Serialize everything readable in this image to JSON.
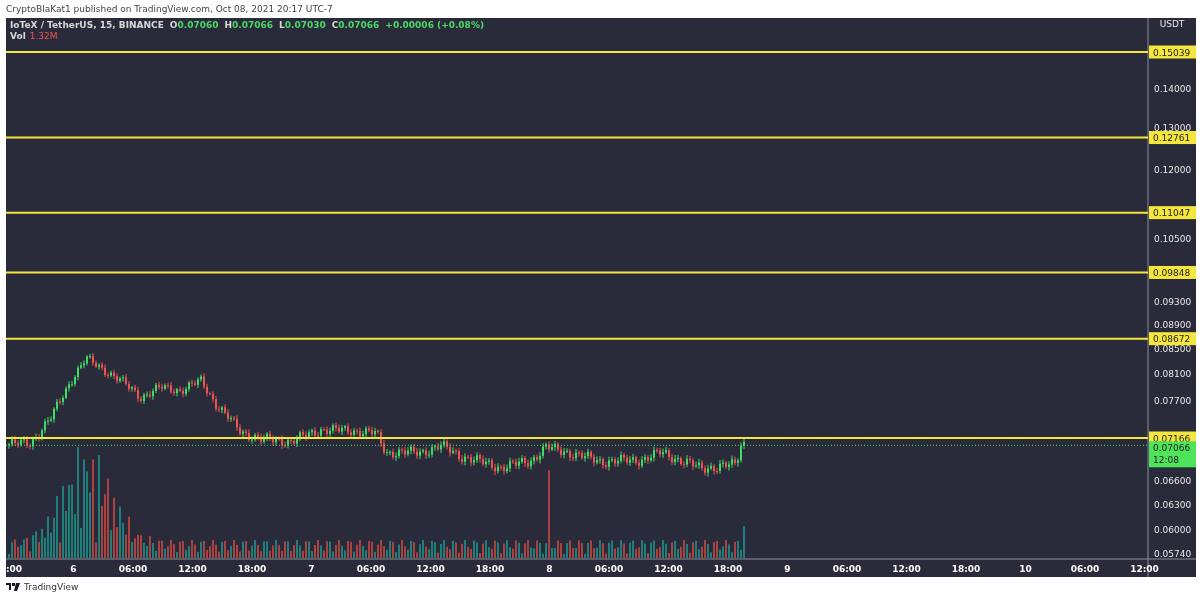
{
  "publish_line": "CryptoBlaKat1 published on TradingView.com, Oct 08, 2021 20:17 UTC-7",
  "chart": {
    "symbol": "IoTeX / TetherUS, 15, BINANCE",
    "ohlc": [
      {
        "key": "O",
        "value": "0.07060"
      },
      {
        "key": "H",
        "value": "0.07066"
      },
      {
        "key": "L",
        "value": "0.07030"
      },
      {
        "key": "C",
        "value": "0.07066"
      }
    ],
    "change": "+0.00006 (+0.08%)",
    "volume": {
      "label": "Vol",
      "value": "1.32M"
    },
    "price_axis": {
      "unit": "USDT",
      "ticks": [
        "0.14000",
        "0.13000",
        "0.12000",
        "0.10500",
        "0.09300",
        "0.08900",
        "0.08500",
        "0.08100",
        "0.07700",
        "0.06600",
        "0.06300",
        "0.06000",
        "0.05740"
      ]
    },
    "levels": [
      {
        "price": "0.15039"
      },
      {
        "price": "0.12761"
      },
      {
        "price": "0.11047"
      },
      {
        "price": "0.09848"
      },
      {
        "price": "0.08672"
      },
      {
        "price": "0.07166"
      }
    ],
    "last_price": {
      "price": "0.07066",
      "countdown": "12:08"
    },
    "time_axis": {
      "ticks": [
        ":00",
        "6",
        "06:00",
        "12:00",
        "18:00",
        "7",
        "06:00",
        "12:00",
        "18:00",
        "8",
        "06:00",
        "12:00",
        "18:00",
        "9",
        "06:00",
        "12:00",
        "18:00",
        "10",
        "06:00",
        "12:00"
      ]
    }
  },
  "footer": {
    "brand": "TradingView"
  }
}
